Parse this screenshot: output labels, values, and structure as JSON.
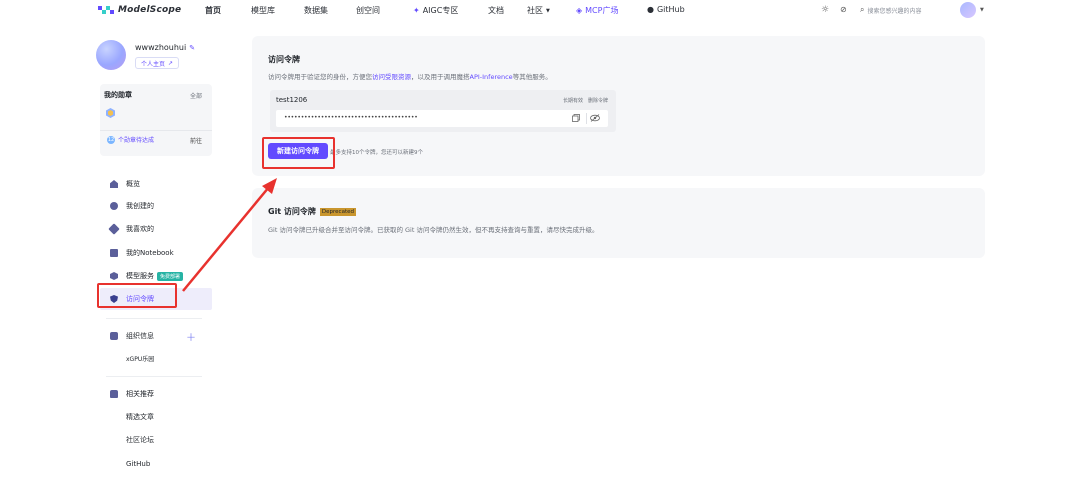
{
  "nav": {
    "logo_text": "ModelScope",
    "items": [
      "首页",
      "模型库",
      "数据集",
      "创空间",
      "AIGC专区",
      "文档",
      "社区",
      "MCP广场",
      "GitHub"
    ],
    "search_placeholder": "搜索您感兴趣的内容"
  },
  "user": {
    "name": "wwwzhouhui",
    "homepage_label": "个人主页"
  },
  "badges": {
    "title": "我的勋章",
    "all_label": "全部",
    "pending_count": "12",
    "pending_label": "个勋章待达成",
    "goto_label": "前往"
  },
  "sidebar": {
    "items": [
      "概览",
      "我创建的",
      "我喜欢的",
      "我的Notebook",
      "模型服务",
      "访问令牌"
    ],
    "free_tag": "免费部署",
    "org_title": "组织信息",
    "org_items": [
      "xGPU乐园"
    ],
    "rec_title": "相关推荐",
    "rec_items": [
      "精选文章",
      "社区论坛",
      "GitHub"
    ]
  },
  "access_token": {
    "title": "访问令牌",
    "desc_prefix": "访问令牌用于验证您的身份，方便您",
    "desc_link1": "访问受限资源",
    "desc_mid": "，以及用于调用魔搭",
    "desc_link2": "API-Inference",
    "desc_suffix": "等其他服务。",
    "token_name": "test1206",
    "validity_label": "长期有效",
    "delete_label": "删除令牌",
    "token_mask": "••••••••••••••••••••••••••••••••••••••••",
    "new_button": "新建访问令牌",
    "hint": "最多支持10个令牌，您还可以新建9个"
  },
  "git_token": {
    "title": "Git 访问令牌",
    "deprecated_label": "Deprecated",
    "desc": "Git 访问令牌已升级合并至访问令牌。已获取的 Git 访问令牌仍然生效，但不再支持查询与重置，请尽快完成升级。"
  },
  "colors": {
    "accent": "#624aff",
    "highlight_red": "#e8322e",
    "deprecated_bg": "#c9962e",
    "free_tag_bg": "#26b3a4"
  }
}
